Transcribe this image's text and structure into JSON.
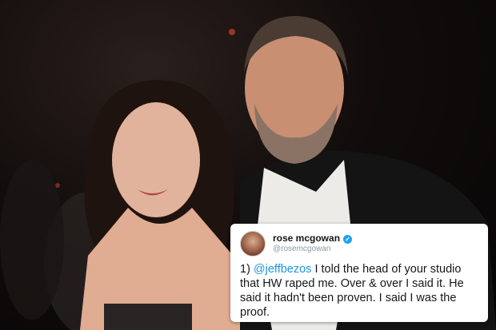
{
  "tweet": {
    "display_name": "rose mcgowan",
    "handle": "@rosemcgowan",
    "verified_glyph": "✓",
    "text_prefix": "1) ",
    "mention": "@jeffbezos",
    "text_body": " I told the head of your studio that HW raped me. Over & over I said it. He said it hadn't been proven. I said I was the proof."
  },
  "colors": {
    "mention": "#1b95e0",
    "verified": "#1da1f2",
    "card_bg": "#ffffff"
  },
  "icons": {
    "verified": "verified-badge-icon",
    "avatar": "user-avatar"
  }
}
